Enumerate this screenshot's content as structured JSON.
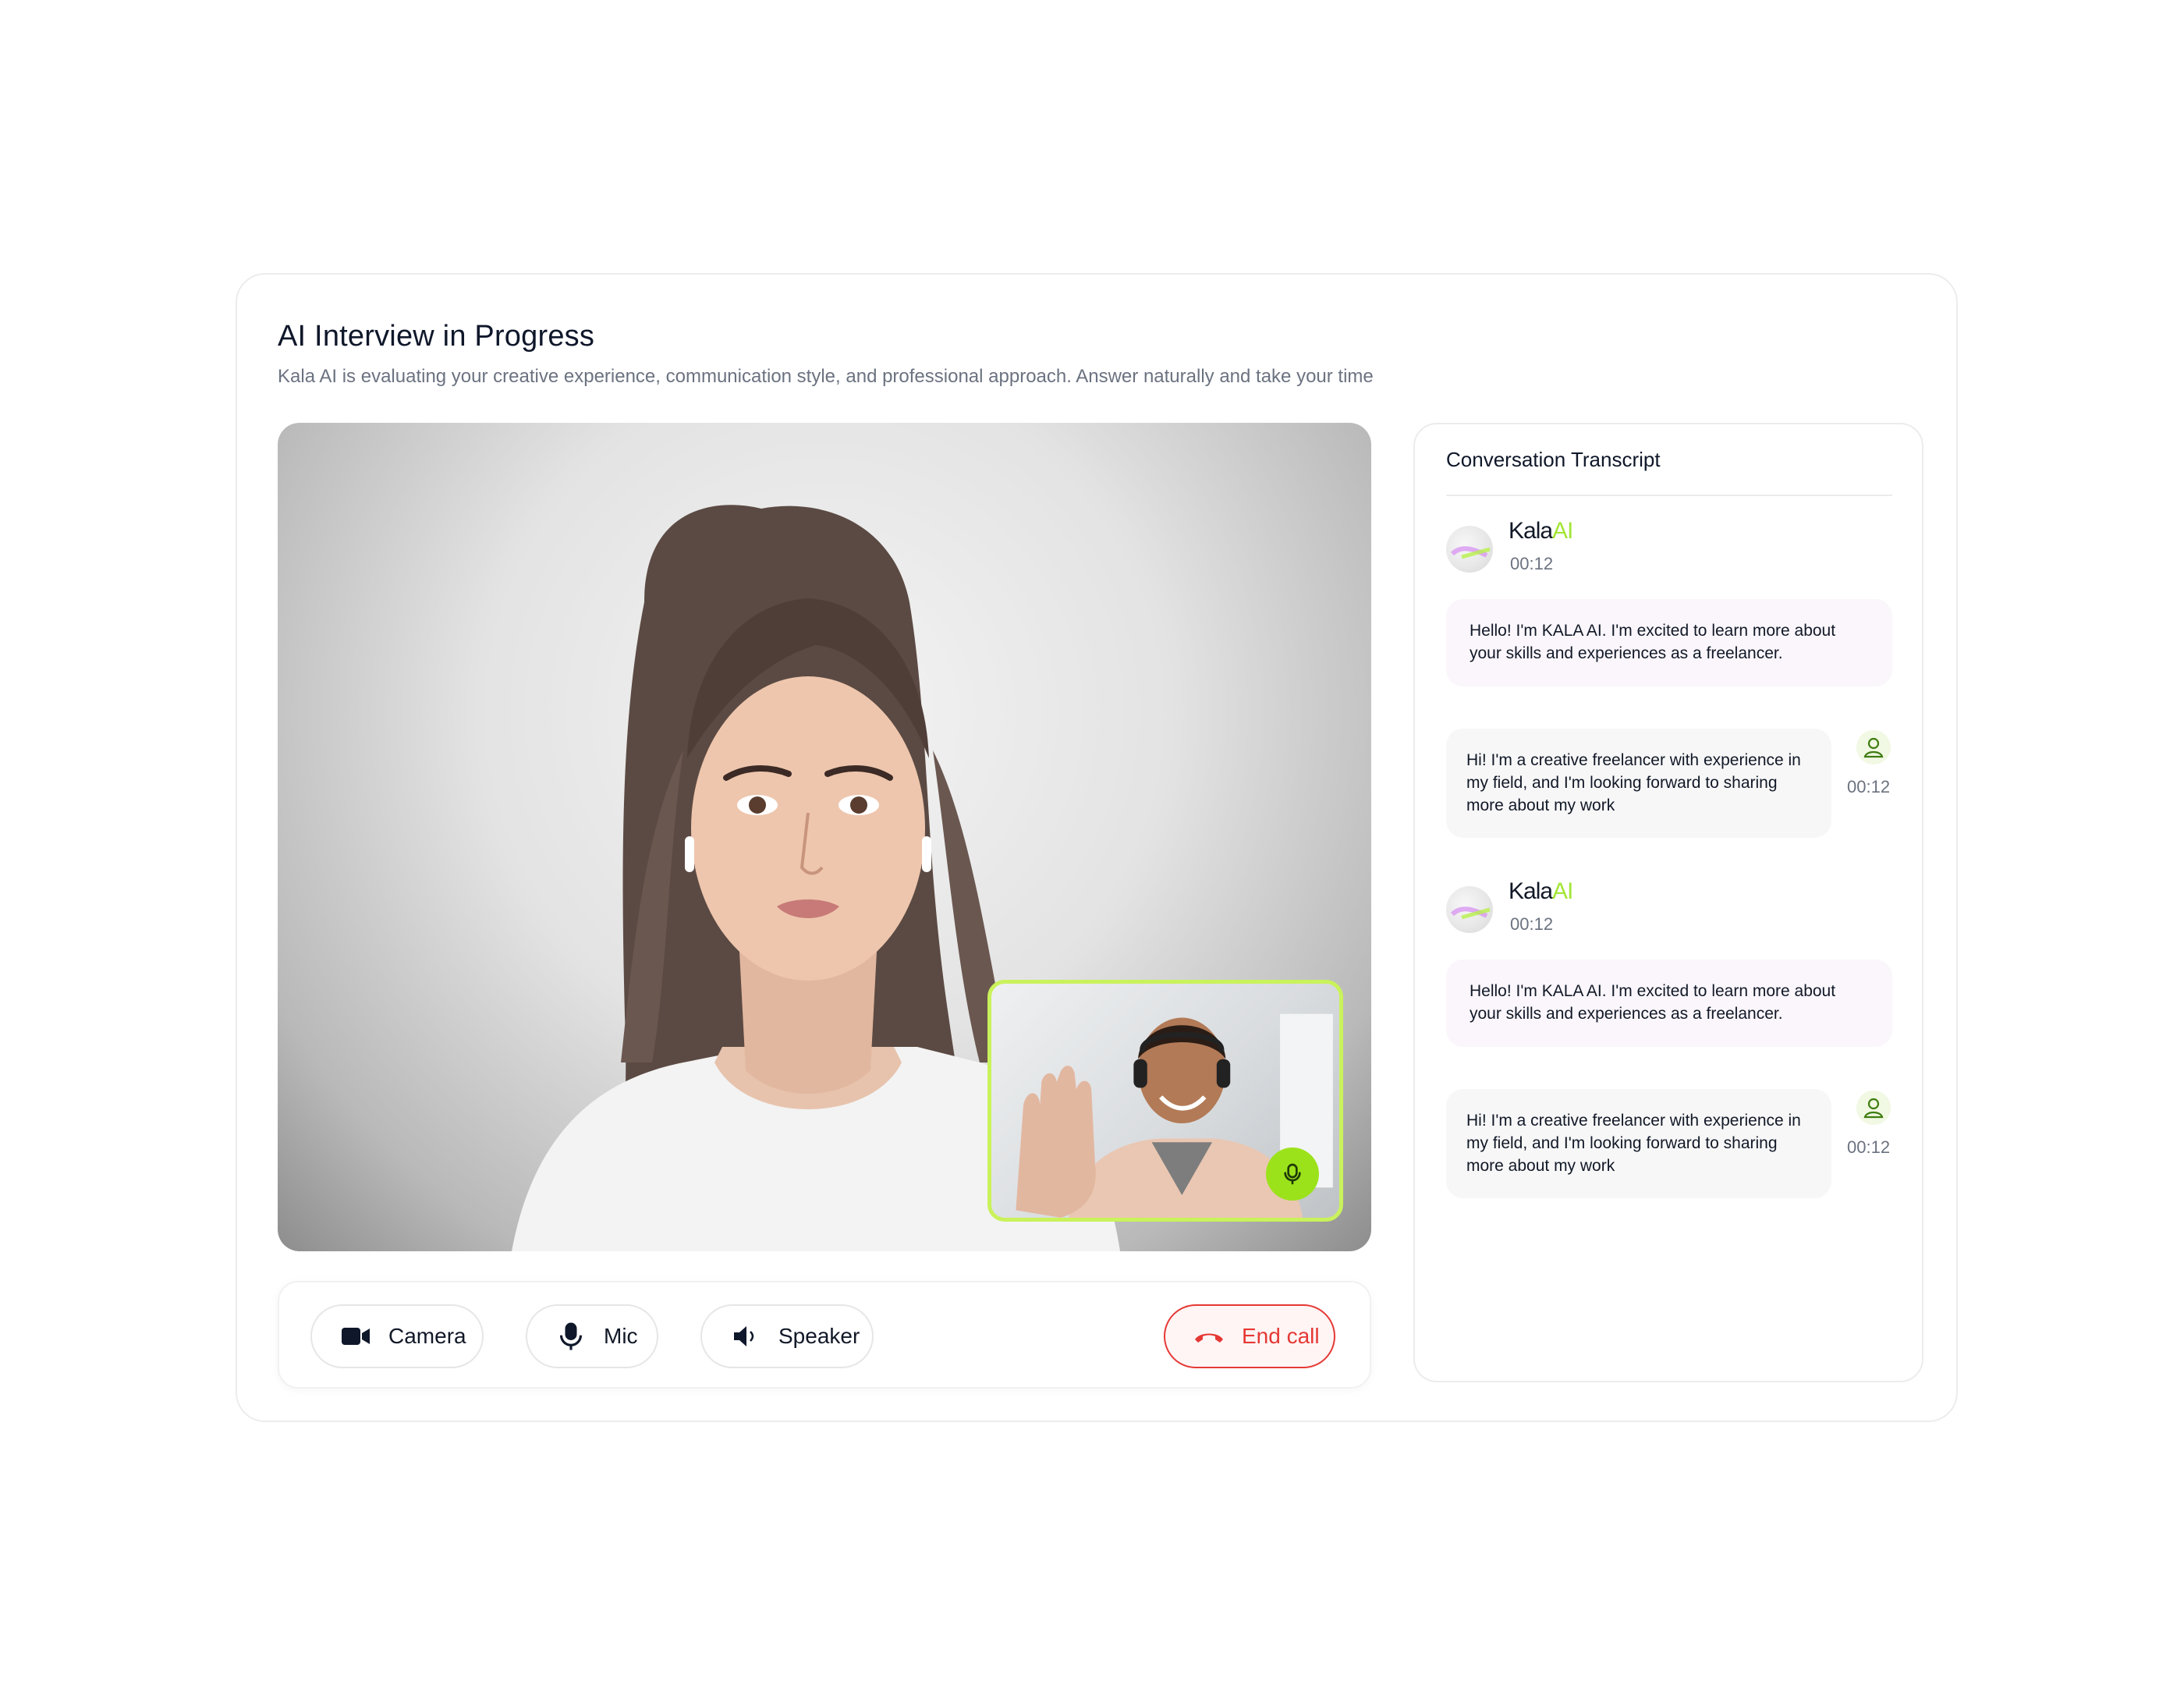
{
  "header": {
    "title": "AI Interview in Progress",
    "subtitle": "Kala AI is evaluating your creative experience, communication style, and professional approach. Answer naturally and take your time"
  },
  "video": {
    "main_participant": "interviewer-video",
    "pip_participant": "candidate-video",
    "pip_mic_icon": "mic-icon",
    "accent": "#9be21b"
  },
  "controls": {
    "camera_label": "Camera",
    "mic_label": "Mic",
    "speaker_label": "Speaker",
    "end_label": "End call",
    "end_color": "#e53935"
  },
  "transcript": {
    "title": "Conversation Transcript",
    "brand_main": "Kala",
    "brand_accent": "AI",
    "messages": [
      {
        "sender": "ai",
        "time": "00:12",
        "text": "Hello! I'm KALA AI. I'm excited to learn more about your skills and experiences as a freelancer."
      },
      {
        "sender": "user",
        "time": "00:12",
        "text": "Hi! I'm a creative freelancer with experience in my field, and I'm looking forward to sharing more about my work"
      },
      {
        "sender": "ai",
        "time": "00:12",
        "text": "Hello! I'm KALA AI. I'm excited to learn more about your skills and experiences as a freelancer."
      },
      {
        "sender": "user",
        "time": "00:12",
        "text": "Hi! I'm a creative freelancer with experience in my field, and I'm looking forward to sharing more about my work"
      }
    ]
  }
}
